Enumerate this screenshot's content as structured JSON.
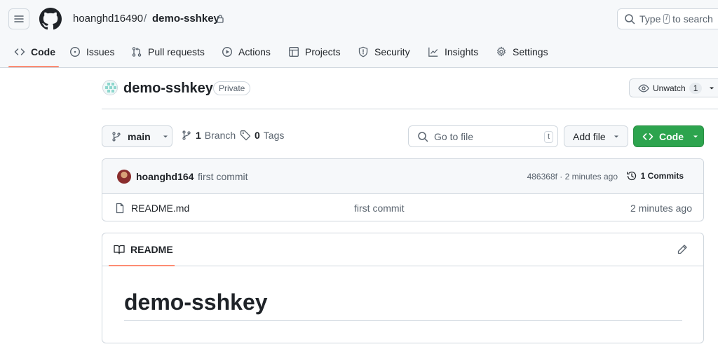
{
  "header": {
    "owner": "hoanghd16490",
    "separator": "/",
    "repo": "demo-sshkey",
    "search": {
      "prefix": "Type",
      "key": "/",
      "suffix": "to search"
    }
  },
  "nav": {
    "tabs": [
      {
        "label": "Code",
        "icon": "code-icon",
        "active": true
      },
      {
        "label": "Issues",
        "icon": "issue-icon"
      },
      {
        "label": "Pull requests",
        "icon": "pull-request-icon"
      },
      {
        "label": "Actions",
        "icon": "play-icon"
      },
      {
        "label": "Projects",
        "icon": "table-icon"
      },
      {
        "label": "Security",
        "icon": "shield-icon"
      },
      {
        "label": "Insights",
        "icon": "graph-icon"
      },
      {
        "label": "Settings",
        "icon": "gear-icon"
      }
    ]
  },
  "repo": {
    "name": "demo-sshkey",
    "visibility": "Private",
    "watch": {
      "label": "Unwatch",
      "count": "1"
    }
  },
  "toolbar": {
    "branch": "main",
    "branches_count": "1",
    "branches_label": "Branch",
    "tags_count": "0",
    "tags_label": "Tags",
    "go_to_file": "Go to file",
    "go_to_file_key": "t",
    "add_file": "Add file",
    "code": "Code"
  },
  "commit": {
    "author": "hoanghd164",
    "message": "first commit",
    "sha_age": "486368f · 2 minutes ago",
    "commits_label": "1 Commits"
  },
  "files": [
    {
      "name": "README.md",
      "message": "first commit",
      "age": "2 minutes ago"
    }
  ],
  "readme": {
    "tab": "README",
    "heading": "demo-sshkey"
  },
  "colors": {
    "accent_underline": "#fd8c73",
    "primary_button": "#2da44e",
    "border": "#d0d7de"
  }
}
